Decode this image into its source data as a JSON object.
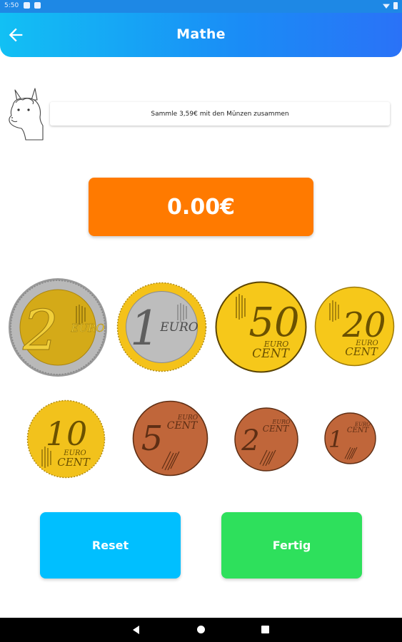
{
  "status_bar": {
    "time": "5:50"
  },
  "app_bar": {
    "title": "Mathe",
    "back_icon": "arrow-left-icon"
  },
  "task": {
    "text": "Sammle 3,59€ mit den Münzen zusammen",
    "mascot_icon": "llama-icon"
  },
  "total": {
    "value": "0.00€"
  },
  "coins": [
    {
      "value": "2",
      "unit": "EURO",
      "kind": "bimetal-2"
    },
    {
      "value": "1",
      "unit": "EURO",
      "kind": "bimetal-1"
    },
    {
      "value": "50",
      "unit_top": "EURO",
      "unit_bottom": "CENT",
      "kind": "gold"
    },
    {
      "value": "20",
      "unit_top": "EURO",
      "unit_bottom": "CENT",
      "kind": "gold"
    },
    {
      "value": "10",
      "unit_top": "EURO",
      "unit_bottom": "CENT",
      "kind": "gold"
    },
    {
      "value": "5",
      "unit_top": "EURO",
      "unit_bottom": "CENT",
      "kind": "copper"
    },
    {
      "value": "2",
      "unit_top": "EURO",
      "unit_bottom": "CENT",
      "kind": "copper"
    },
    {
      "value": "1",
      "unit_top": "EURO",
      "unit_bottom": "CENT",
      "kind": "copper"
    }
  ],
  "buttons": {
    "reset": "Reset",
    "done": "Fertig"
  },
  "colors": {
    "app_bar_start": "#12c0f4",
    "app_bar_end": "#2a72f7",
    "total": "#ff7a00",
    "reset": "#00bfff",
    "done": "#2ee05c",
    "gold": "#f5c518",
    "silver": "#b9b9b9",
    "copper": "#c0663a"
  }
}
